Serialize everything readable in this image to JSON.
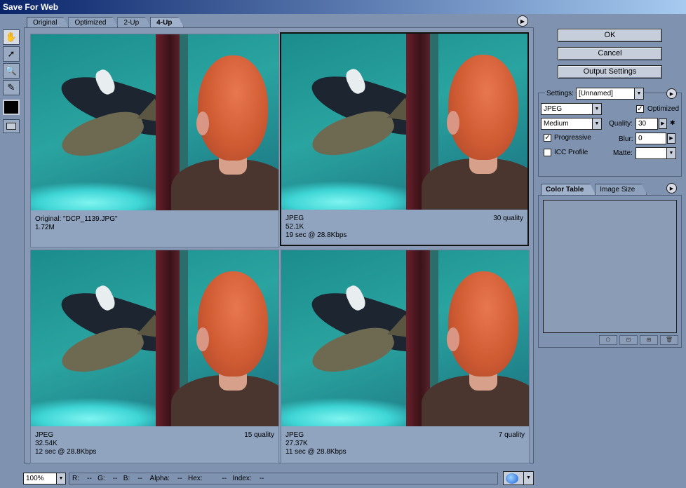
{
  "window": {
    "title": "Save For Web"
  },
  "tabs": [
    {
      "label": "Original"
    },
    {
      "label": "Optimized"
    },
    {
      "label": "2-Up"
    },
    {
      "label": "4-Up",
      "active": true
    }
  ],
  "panes": [
    {
      "line1": "Original: \"DCP_1139.JPG\"",
      "line2": "1.72M",
      "line3": "",
      "quality": ""
    },
    {
      "line1": "JPEG",
      "line2": "52.1K",
      "line3": "19 sec @ 28.8Kbps",
      "quality": "30 quality",
      "selected": true
    },
    {
      "line1": "JPEG",
      "line2": "32.54K",
      "line3": "12 sec @ 28.8Kbps",
      "quality": "15 quality"
    },
    {
      "line1": "JPEG",
      "line2": "27.37K",
      "line3": "11 sec @ 28.8Kbps",
      "quality": "7 quality"
    }
  ],
  "buttons": {
    "ok": "OK",
    "cancel": "Cancel",
    "output": "Output Settings"
  },
  "settings": {
    "label": "Settings:",
    "preset": "[Unnamed]",
    "format": "JPEG",
    "quality_level": "Medium",
    "optimized_label": "Optimized",
    "optimized": true,
    "quality_label": "Quality:",
    "quality_value": "30",
    "progressive_label": "Progressive",
    "progressive": true,
    "blur_label": "Blur:",
    "blur_value": "0",
    "icc_label": "ICC Profile",
    "icc": false,
    "matte_label": "Matte:"
  },
  "color_panel": {
    "tabs": [
      "Color Table",
      "Image Size"
    ]
  },
  "status": {
    "zoom": "100%",
    "readout": "R:    --   G:    --   B:    --    Alpha:    --   Hex:          --   Index:    --"
  },
  "colors": {
    "background": "#7f93b0",
    "titlebar": "#0a246a"
  }
}
